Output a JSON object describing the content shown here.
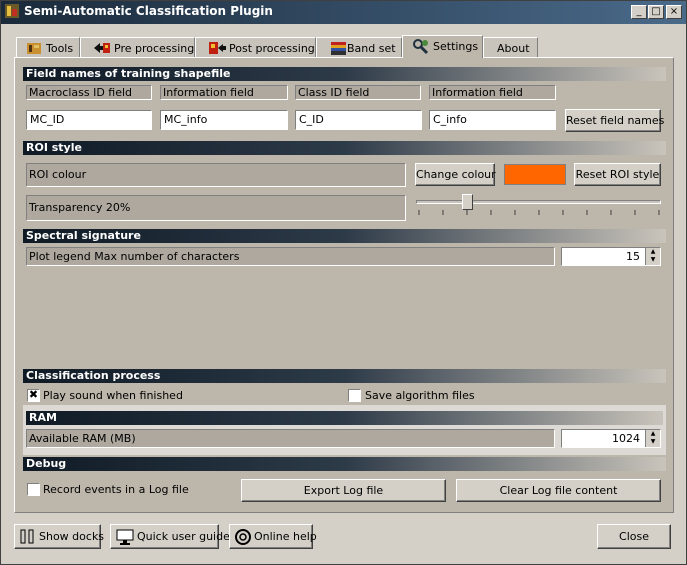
{
  "window": {
    "title": "Semi-Automatic Classification Plugin",
    "controls": {
      "minimize": "_",
      "maximize": "□",
      "close": "×"
    }
  },
  "tabs": [
    {
      "label": "Tools",
      "icon": "tools-icon"
    },
    {
      "label": "Pre processing",
      "icon": "pre-processing-icon"
    },
    {
      "label": "Post processing",
      "icon": "post-processing-icon"
    },
    {
      "label": "Band set",
      "icon": "band-set-icon"
    },
    {
      "label": "Settings",
      "icon": "settings-wrench-icon",
      "active": true
    },
    {
      "label": "About"
    }
  ],
  "field_names": {
    "header": "Field names of training shapefile",
    "macroclass_label": "Macroclass ID field",
    "macroclass_value": "MC_ID",
    "info_label": "Information field",
    "info_value": "MC_info",
    "class_label": "Class ID field",
    "class_value": "C_ID",
    "cinfo_label": "Information field",
    "cinfo_value": "C_info",
    "reset_button": "Reset field names"
  },
  "roi_style": {
    "header": "ROI style",
    "colour_label": "ROI colour",
    "change_colour_button": "Change colour",
    "colour_swatch": "#ff6600",
    "reset_button": "Reset ROI style",
    "transparency_label": "Transparency 20%",
    "transparency_value": 20
  },
  "spectral_signature": {
    "header": "Spectral signature",
    "legend_label": "Plot legend Max number of characters",
    "legend_value": "15"
  },
  "classification_process": {
    "header": "Classification process",
    "play_sound_label": "Play sound when finished",
    "play_sound_checked": true,
    "save_algorithm_label": "Save algorithm files",
    "save_algorithm_checked": false
  },
  "ram": {
    "header": "RAM",
    "available_label": "Available RAM (MB)",
    "available_value": "1024"
  },
  "debug": {
    "header": "Debug",
    "record_label": "Record events in a Log file",
    "record_checked": false,
    "export_button": "Export Log file",
    "clear_button": "Clear Log file content"
  },
  "footer": {
    "show_docks": "Show docks",
    "quick_guide": "Quick user guide",
    "online_help": "Online help",
    "close": "Close"
  }
}
